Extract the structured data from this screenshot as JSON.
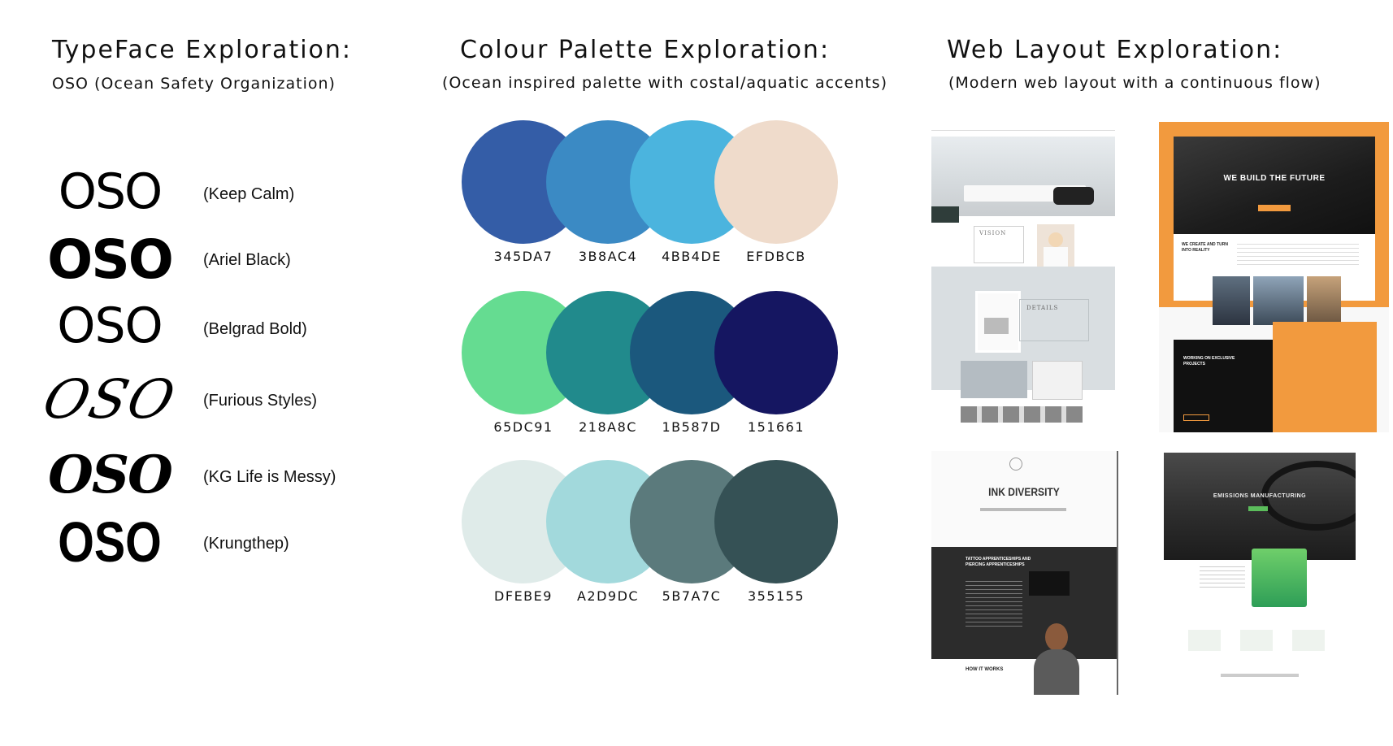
{
  "typeface": {
    "heading": "TypeFace Exploration:",
    "subheading": "OSO (Ocean Safety Organization)",
    "samples": [
      {
        "text": "OSO",
        "font": "(Keep Calm)"
      },
      {
        "text": "OSO",
        "font": "(Ariel Black)"
      },
      {
        "text": "OSO",
        "font": "(Belgrad Bold)"
      },
      {
        "text": "OSO",
        "font": "(Furious Styles)"
      },
      {
        "text": "OSO",
        "font": "(KG Life is Messy)"
      },
      {
        "text": "OSO",
        "font": "(Krungthep)"
      }
    ]
  },
  "palette": {
    "heading": "Colour Palette Exploration:",
    "subheading": "(Ocean inspired palette with costal/aquatic accents)",
    "rows": [
      [
        {
          "hex": "345DA7",
          "color": "#345DA7"
        },
        {
          "hex": "3B8AC4",
          "color": "#3B8AC4"
        },
        {
          "hex": "4BB4DE",
          "color": "#4BB4DE"
        },
        {
          "hex": "EFDBCB",
          "color": "#EFDBCB"
        }
      ],
      [
        {
          "hex": "65DC91",
          "color": "#65DC91"
        },
        {
          "hex": "218A8C",
          "color": "#218A8C"
        },
        {
          "hex": "1B587D",
          "color": "#1B587D"
        },
        {
          "hex": "151661",
          "color": "#151661"
        }
      ],
      [
        {
          "hex": "DFEBE9",
          "color": "#DFEBE9"
        },
        {
          "hex": "A2D9DC",
          "color": "#A2D9DC"
        },
        {
          "hex": "5B7A7C",
          "color": "#5B7A7C"
        },
        {
          "hex": "355155",
          "color": "#355155"
        }
      ]
    ]
  },
  "layout": {
    "heading": "Web Layout Exploration:",
    "subheading": "(Modern web layout with a continuous flow)",
    "thumbs": {
      "interior": {
        "title": "VISION",
        "section": "DETAILS"
      },
      "orange": {
        "headline": "WE BUILD THE FUTURE",
        "subhead": "WE CREATE AND TURN INTO REALITY",
        "cta": "WORKING ON EXCLUSIVE PROJECTS"
      },
      "tattoo": {
        "headline": "INK DIVERSITY",
        "section": "TATTOO APPRENTICESHIPS AND PIERCING APPRENTICESHIPS",
        "footer": "HOW IT WORKS"
      },
      "emissions": {
        "headline": "EMISSIONS MANUFACTURING"
      }
    }
  }
}
